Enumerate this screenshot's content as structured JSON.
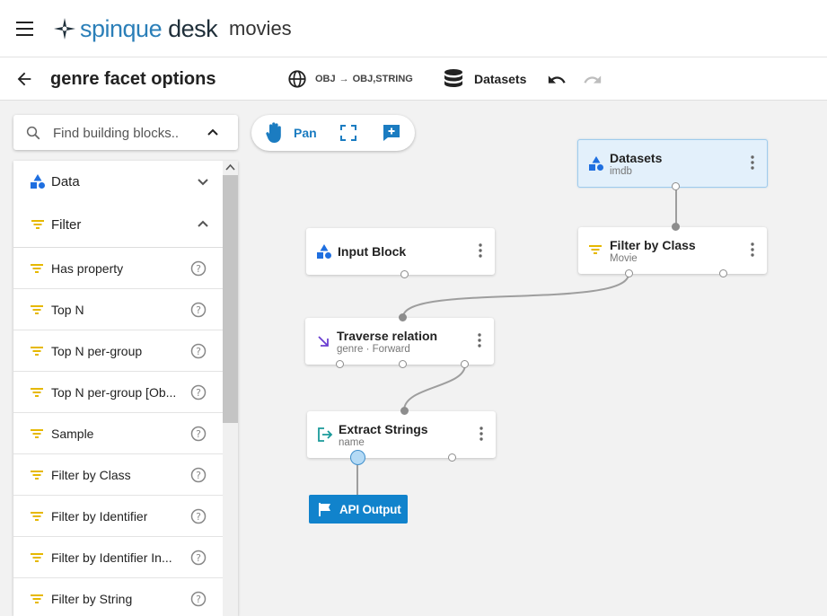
{
  "app": {
    "logo": {
      "prefix": "spinque",
      "suffix": "desk"
    },
    "title": "movies"
  },
  "subbar": {
    "page_title": "genre facet options",
    "type_signature": {
      "from": "OBJ",
      "to": "OBJ,STRING"
    },
    "datasets_label": "Datasets"
  },
  "search": {
    "placeholder": "Find building blocks.."
  },
  "categories": [
    {
      "label": "Data",
      "icon": "shapes-icon",
      "expanded": false
    },
    {
      "label": "Filter",
      "icon": "filter-icon",
      "expanded": true
    }
  ],
  "filter_items": [
    {
      "label": "Has property"
    },
    {
      "label": "Top N"
    },
    {
      "label": "Top N per-group"
    },
    {
      "label": "Top N per-group [Ob..."
    },
    {
      "label": "Sample"
    },
    {
      "label": "Filter by Class"
    },
    {
      "label": "Filter by Identifier"
    },
    {
      "label": "Filter by Identifier In..."
    },
    {
      "label": "Filter by String"
    }
  ],
  "canvas_toolbar": {
    "pan_label": "Pan"
  },
  "nodes": {
    "datasets": {
      "title": "Datasets",
      "subtitle": "imdb"
    },
    "input_block": {
      "title": "Input Block"
    },
    "filter_by_class": {
      "title": "Filter by Class",
      "subtitle": "Movie"
    },
    "traverse_relation": {
      "title": "Traverse relation",
      "subtitle": "genre · Forward"
    },
    "extract_strings": {
      "title": "Extract Strings",
      "subtitle": "name"
    }
  },
  "api_output": {
    "label": "API Output"
  },
  "colors": {
    "accent_blue": "#1183cc",
    "filter_yellow": "#e6b800",
    "data_blue": "#1f6fe0",
    "traverse_purple": "#6b3fd1",
    "extract_teal": "#1a9a9a",
    "selected_node_bg": "#e3f0fb"
  }
}
